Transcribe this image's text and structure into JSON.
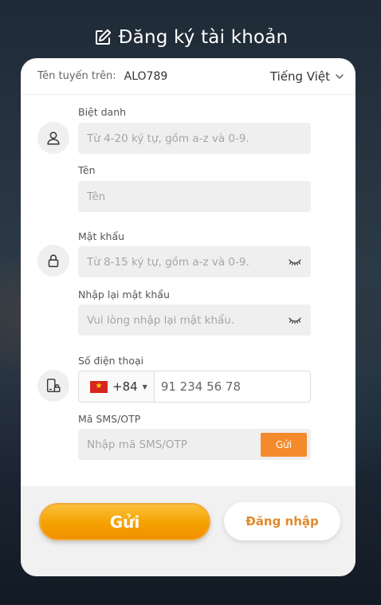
{
  "header": {
    "title": "Đăng ký tài khoản",
    "icon": "edit-icon"
  },
  "topbar": {
    "line_label": "Tên tuyến trên:",
    "line_value": "ALO789",
    "language": "Tiếng Việt"
  },
  "form": {
    "nickname": {
      "label": "Biệt danh",
      "placeholder": "Từ 4-20 ký tự, gồm a-z và 0-9."
    },
    "name": {
      "label": "Tên",
      "placeholder": "Tên"
    },
    "password": {
      "label": "Mật khẩu",
      "placeholder": "Từ 8-15 ký tự, gồm a-z và 0-9."
    },
    "confirm_password": {
      "label": "Nhập lại mật khẩu",
      "placeholder": "Vui lòng nhập lại mật khẩu."
    },
    "phone": {
      "label": "Số điện thoại",
      "country_code": "+84",
      "placeholder": "91 234 56 78"
    },
    "otp": {
      "label": "Mã SMS/OTP",
      "placeholder": "Nhập mã SMS/OTP",
      "send_label": "Gửi"
    }
  },
  "actions": {
    "submit_label": "Gửi",
    "login_label": "Đăng nhập"
  },
  "colors": {
    "accent": "#f48a2b",
    "submit_gradient_top": "#fbc03a",
    "submit_gradient_bottom": "#f19000",
    "login_text": "#e08a2c",
    "field_bg": "#efefef"
  }
}
